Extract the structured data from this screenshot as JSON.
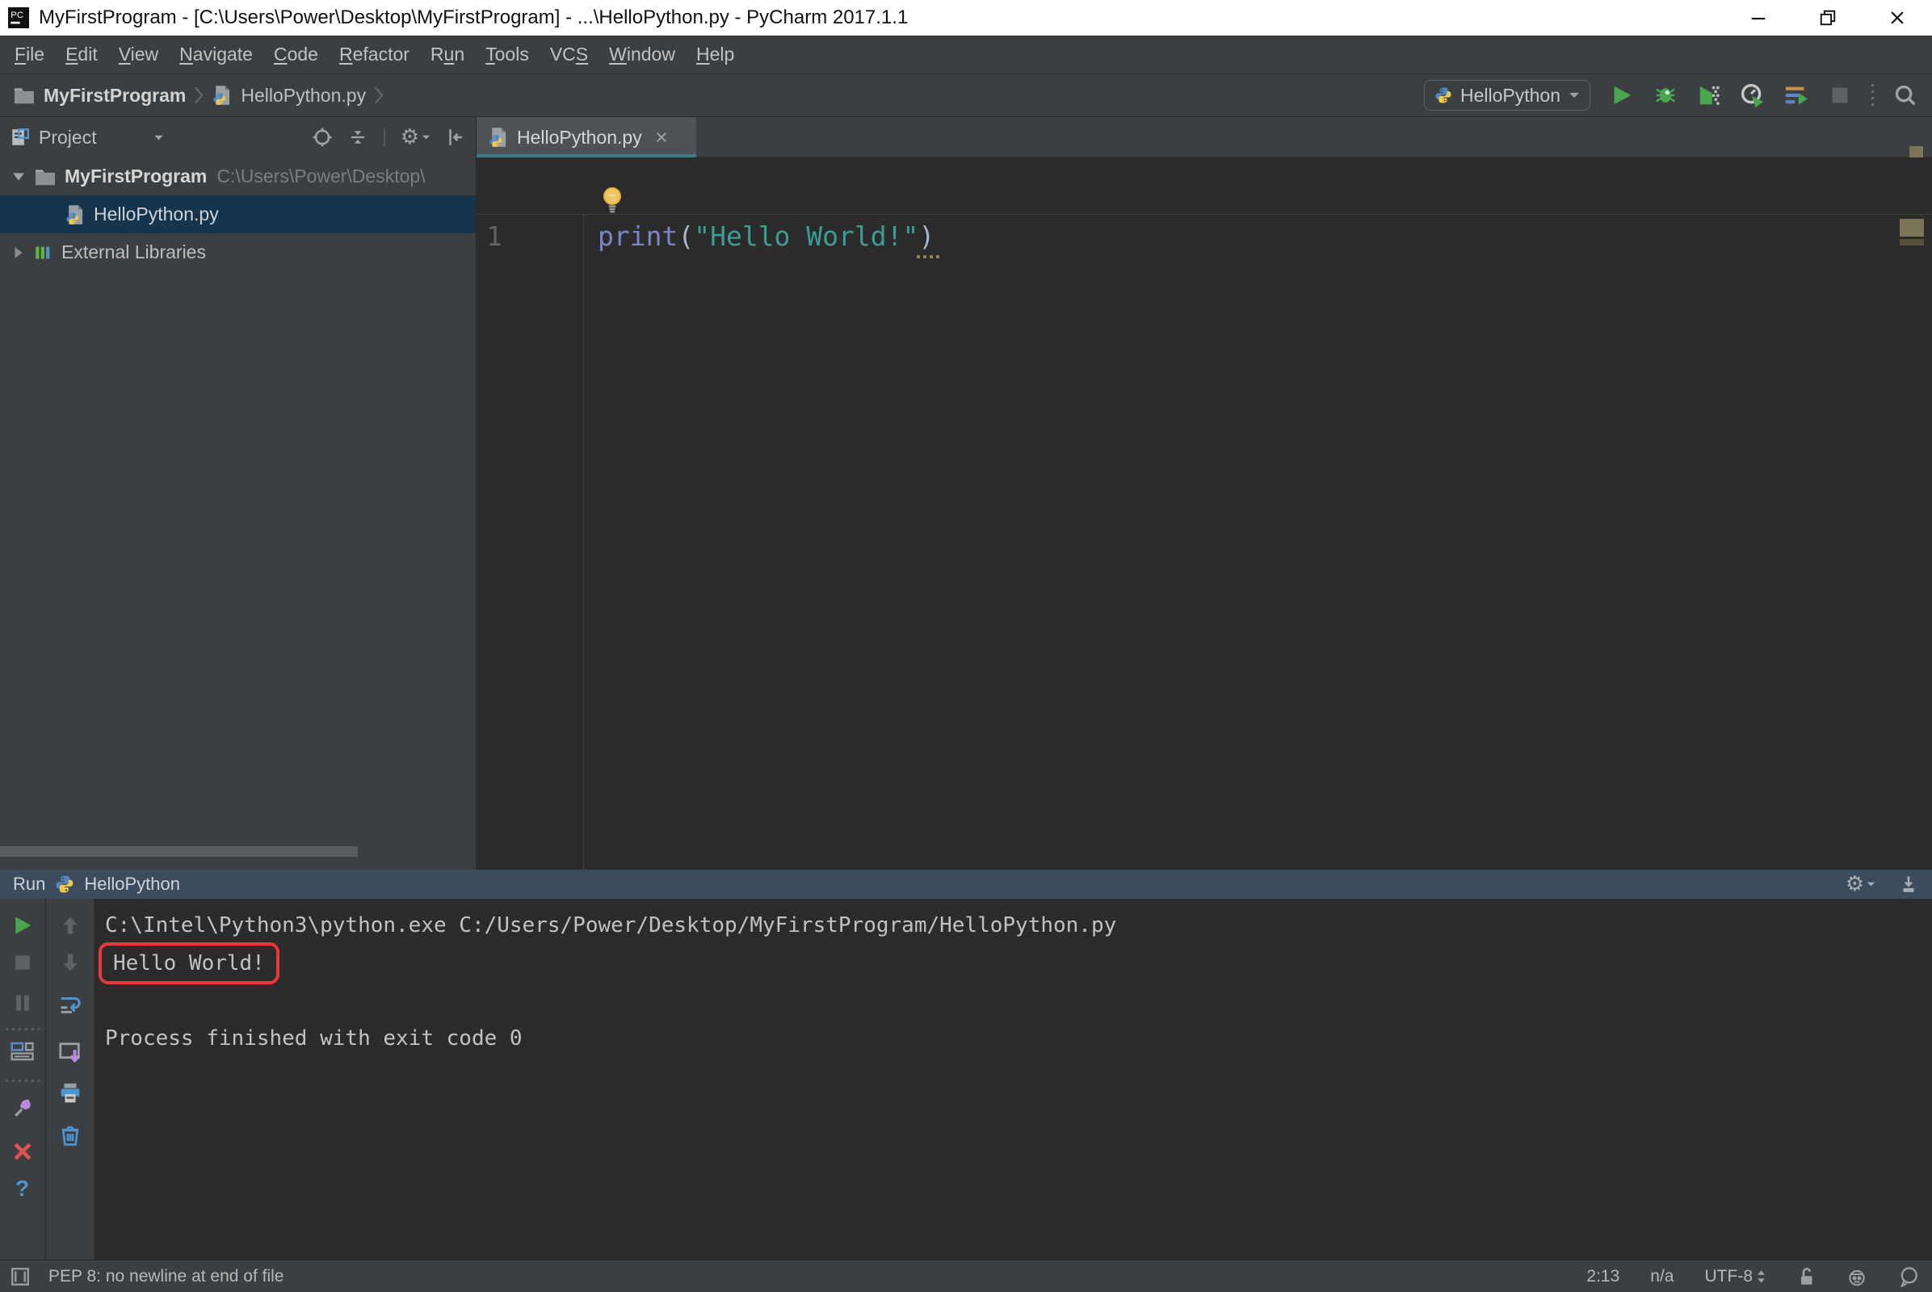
{
  "window": {
    "title": "MyFirstProgram - [C:\\Users\\Power\\Desktop\\MyFirstProgram] - ...\\HelloPython.py - PyCharm 2017.1.1"
  },
  "menu": {
    "items": [
      "File",
      "Edit",
      "View",
      "Navigate",
      "Code",
      "Refactor",
      "Run",
      "Tools",
      "VCS",
      "Window",
      "Help"
    ],
    "mnemonic_index": [
      0,
      0,
      0,
      0,
      0,
      0,
      1,
      0,
      2,
      0,
      0
    ]
  },
  "navbar": {
    "breadcrumb_project": "MyFirstProgram",
    "breadcrumb_file": "HelloPython.py",
    "run_config": "HelloPython"
  },
  "project_panel": {
    "title": "Project",
    "root_name": "MyFirstProgram",
    "root_path": "C:\\Users\\Power\\Desktop\\",
    "file_name": "HelloPython.py",
    "libraries_label": "External Libraries"
  },
  "editor": {
    "tab_label": "HelloPython.py",
    "line_number": "1",
    "code": {
      "keyword": "print",
      "paren_open": "(",
      "string": "\"Hello World!\"",
      "paren_close": ")"
    }
  },
  "run_panel": {
    "tool_label": "Run",
    "config_name": "HelloPython",
    "console": [
      "C:\\Intel\\Python3\\python.exe C:/Users/Power/Desktop/MyFirstProgram/HelloPython.py",
      "Hello World!",
      "",
      "Process finished with exit code 0"
    ]
  },
  "status_bar": {
    "message": "PEP 8: no newline at end of file",
    "caret": "2:13",
    "line_separator": "n/a",
    "encoding": "UTF-8"
  },
  "colors": {
    "panel_bg": "#3c3f41",
    "editor_bg": "#2b2b2b",
    "run_header_bg": "#3d4b5e",
    "tab_accent_teal": "#3d7b87",
    "selection_blue": "#16344b",
    "run_green": "#4aa54f",
    "annotation_red": "#e8383e",
    "keyword_color": "#7a86c9",
    "string_color": "#3a9e96",
    "warning_stripe": "#7c7457"
  }
}
